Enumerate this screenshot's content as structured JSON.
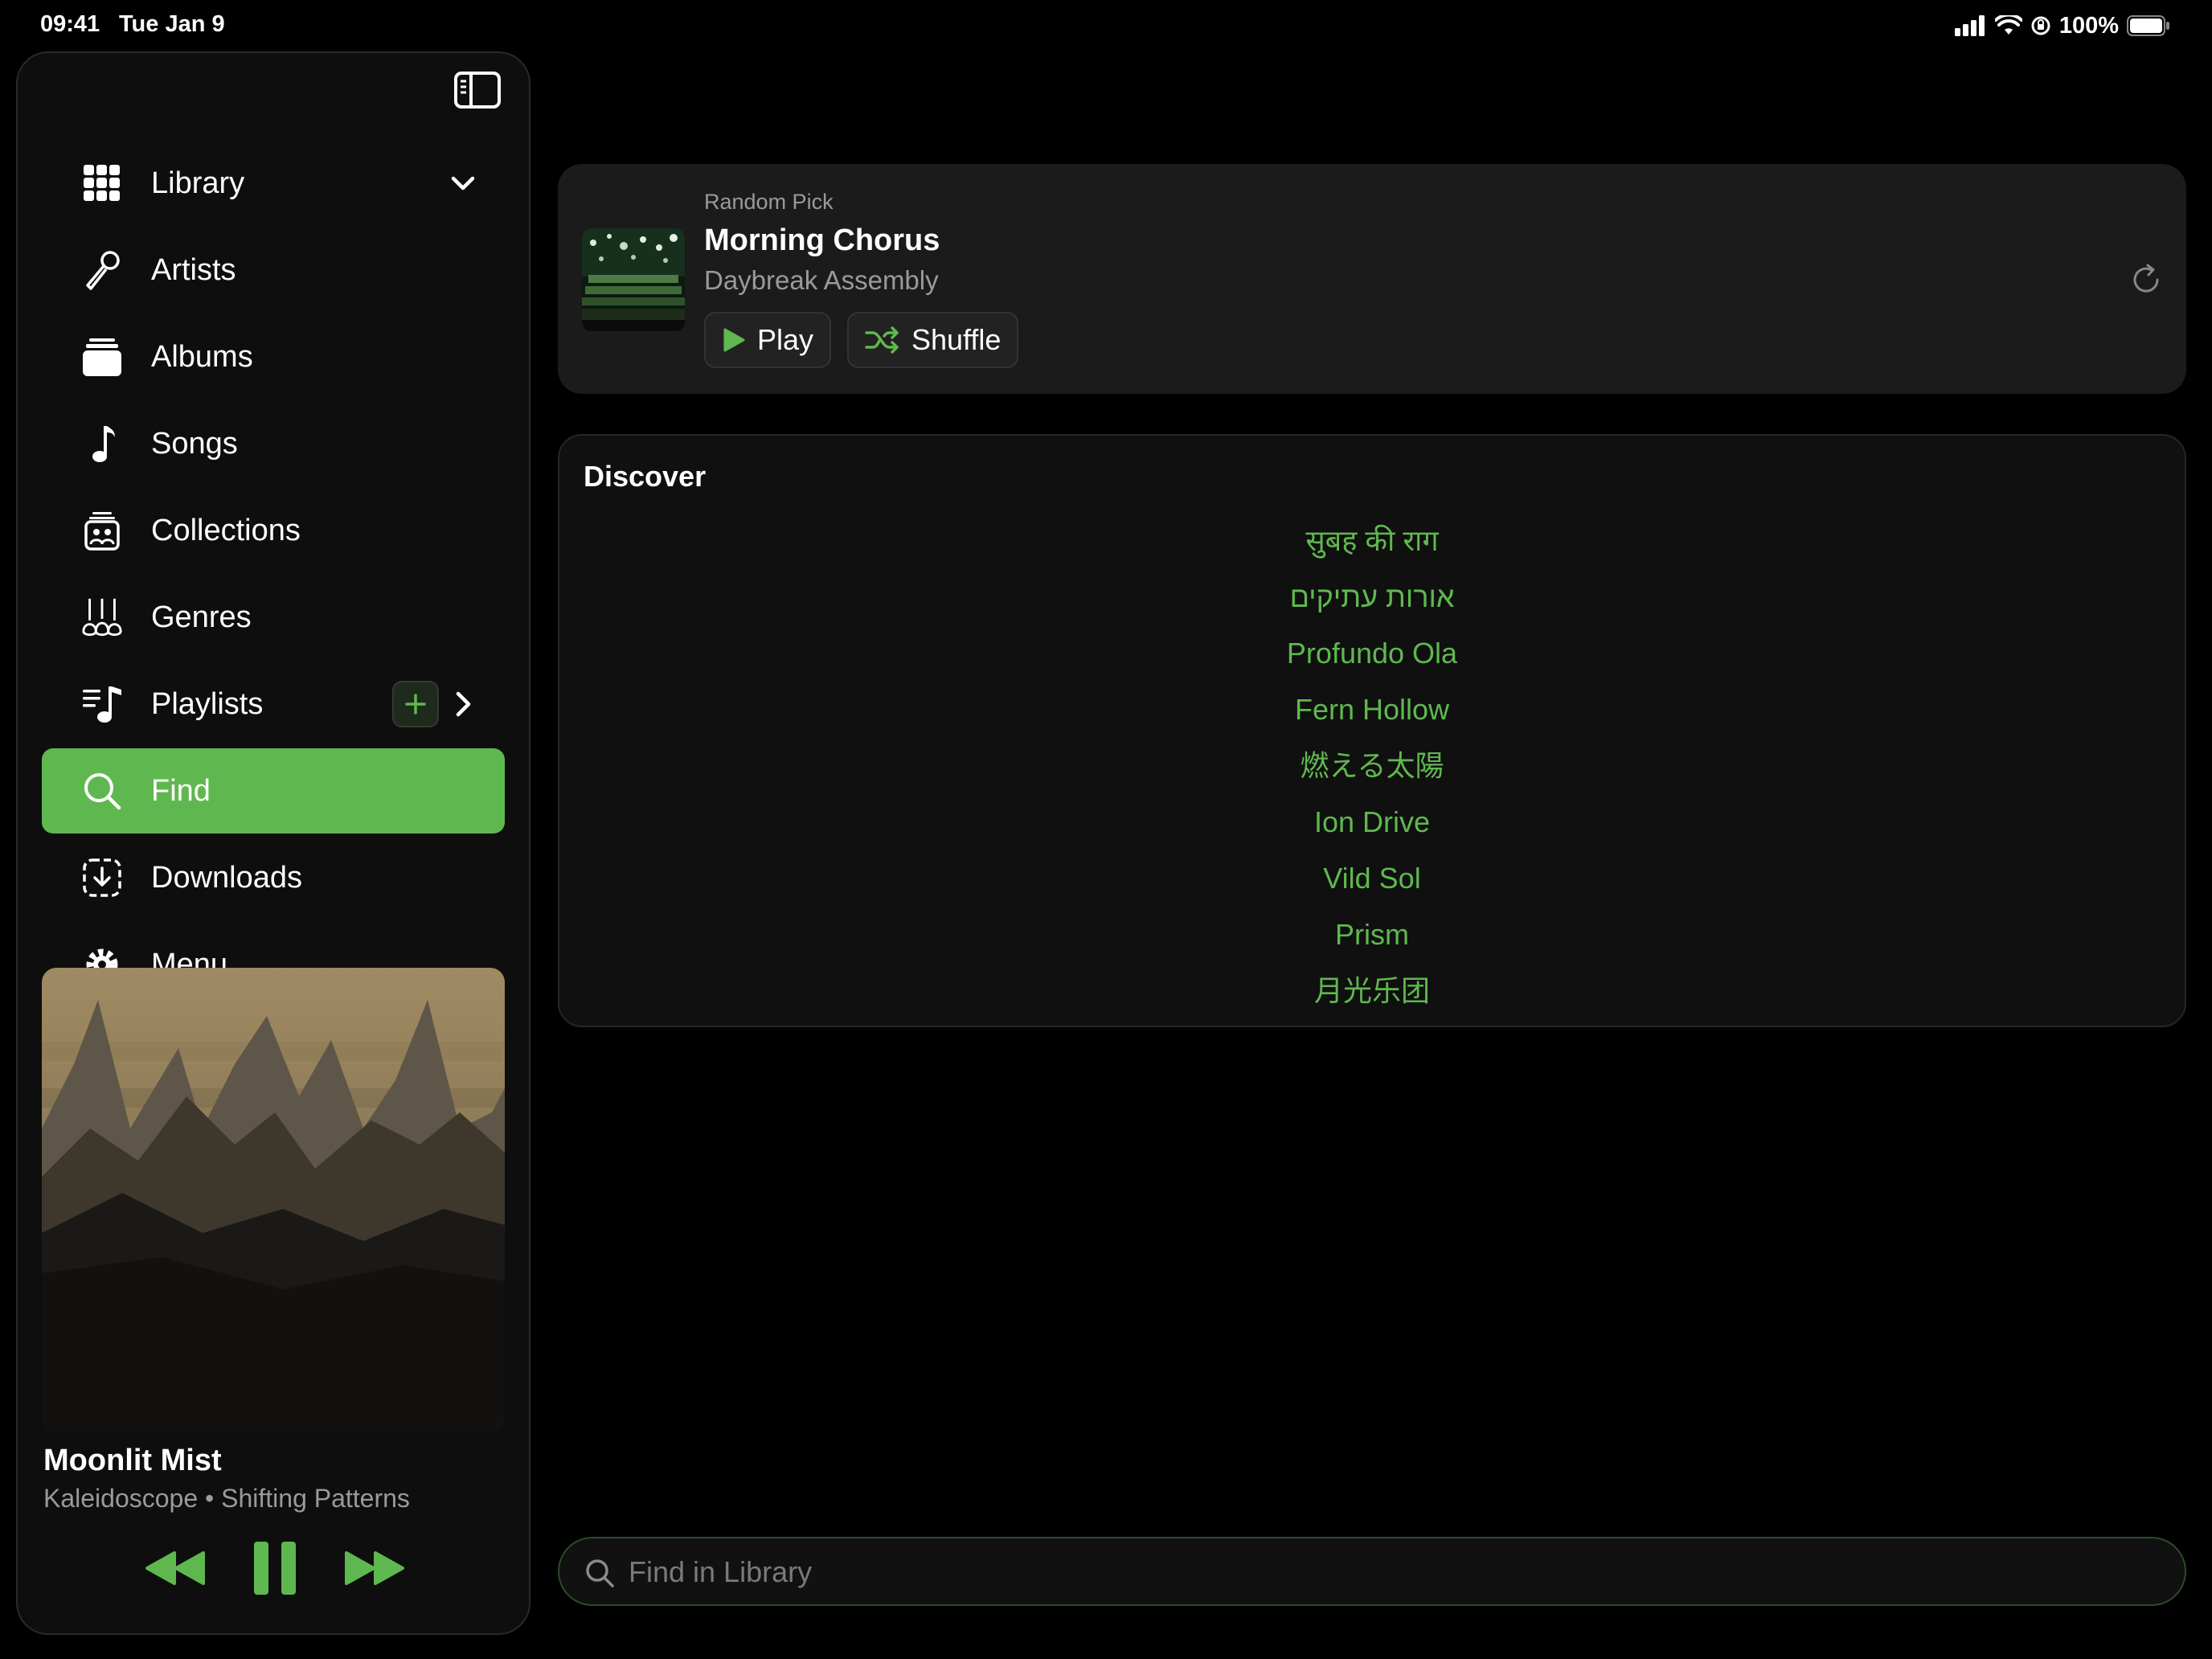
{
  "status_bar": {
    "time": "09:41",
    "date": "Tue Jan 9",
    "battery": "100%"
  },
  "sidebar": {
    "items": [
      {
        "label": "Library",
        "icon": "grid-icon"
      },
      {
        "label": "Artists",
        "icon": "microphone-icon"
      },
      {
        "label": "Albums",
        "icon": "albums-stack-icon"
      },
      {
        "label": "Songs",
        "icon": "music-note-icon"
      },
      {
        "label": "Collections",
        "icon": "collections-icon"
      },
      {
        "label": "Genres",
        "icon": "guitars-icon"
      },
      {
        "label": "Playlists",
        "icon": "playlist-icon"
      },
      {
        "label": "Find",
        "icon": "search-icon",
        "active": true
      },
      {
        "label": "Downloads",
        "icon": "download-icon"
      },
      {
        "label": "Menu",
        "icon": "gear-icon"
      }
    ]
  },
  "now_playing": {
    "title": "Moonlit Mist",
    "subtitle": "Kaleidoscope • Shifting Patterns",
    "is_playing": true
  },
  "random_pick": {
    "caption": "Random Pick",
    "title": "Morning Chorus",
    "artist": "Daybreak Assembly",
    "play_label": "Play",
    "shuffle_label": "Shuffle"
  },
  "discover": {
    "title": "Discover",
    "items": [
      "सुबह की राग",
      "אורות עתיקים",
      "Profundo Ola",
      "Fern Hollow",
      "燃える太陽",
      "Ion Drive",
      "Vild Sol",
      "Prism",
      "月光乐团"
    ]
  },
  "search": {
    "placeholder": "Find in Library"
  },
  "colors": {
    "accent": "#5fb84f",
    "background": "#000000",
    "card": "#1b1b1b"
  }
}
